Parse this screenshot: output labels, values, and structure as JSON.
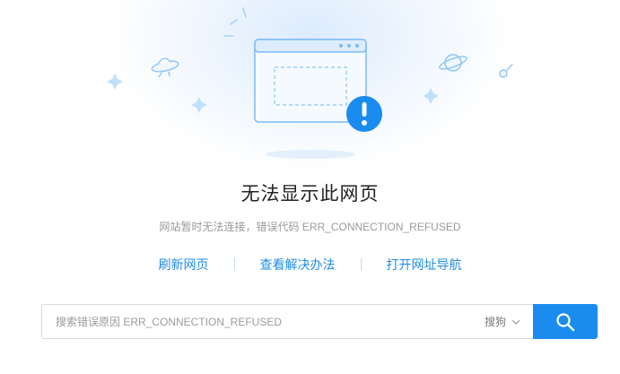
{
  "error_page": {
    "title": "无法显示此网页",
    "subtitle": "网站暂时无法连接，错误代码 ERR_CONNECTION_REFUSED",
    "links": {
      "refresh": "刷新网页",
      "solutions": "查看解决办法",
      "nav": "打开网址导航"
    }
  },
  "search": {
    "placeholder": "搜索错误原因 ERR_CONNECTION_REFUSED",
    "engine": "搜狗",
    "engine_icon": "chevron-down-icon",
    "button_icon": "search-icon"
  },
  "colors": {
    "accent": "#1a8bef",
    "link": "#1e8ce6",
    "illustration_line": "#8cc4f4",
    "illustration_fill": "#eaf4fe",
    "alert_icon_bg": "#1a8bef"
  }
}
